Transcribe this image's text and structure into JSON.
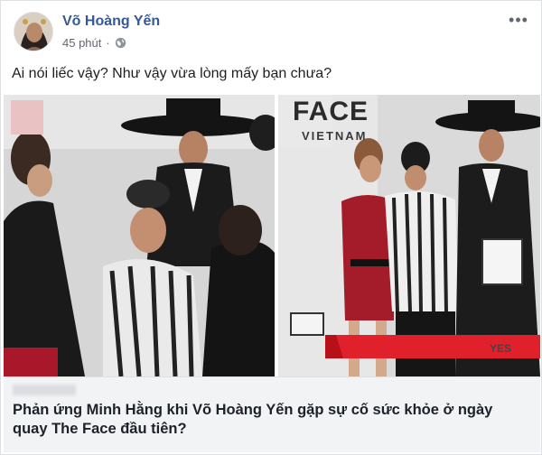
{
  "post": {
    "author": "Võ Hoàng Yến",
    "time": "45 phút",
    "separator": "·",
    "privacy_icon": "globe-icon",
    "more_icon": "more-options-icon",
    "text": "Ai nói liếc vậy? Như vậy vừa lòng mấy bạn chưa?"
  },
  "photo": {
    "overlay_brand": "FACE",
    "overlay_sub": "VIETNAM",
    "card_text": "YES"
  },
  "link_preview": {
    "title": "Phản ứng Minh Hằng khi Võ Hoàng Yến gặp sự cố sức khỏe ở ngày quay The Face đầu tiên?"
  },
  "colors": {
    "author_link": "#365899",
    "accent_red": "#e0202b",
    "link_bg": "#f2f3f5"
  }
}
